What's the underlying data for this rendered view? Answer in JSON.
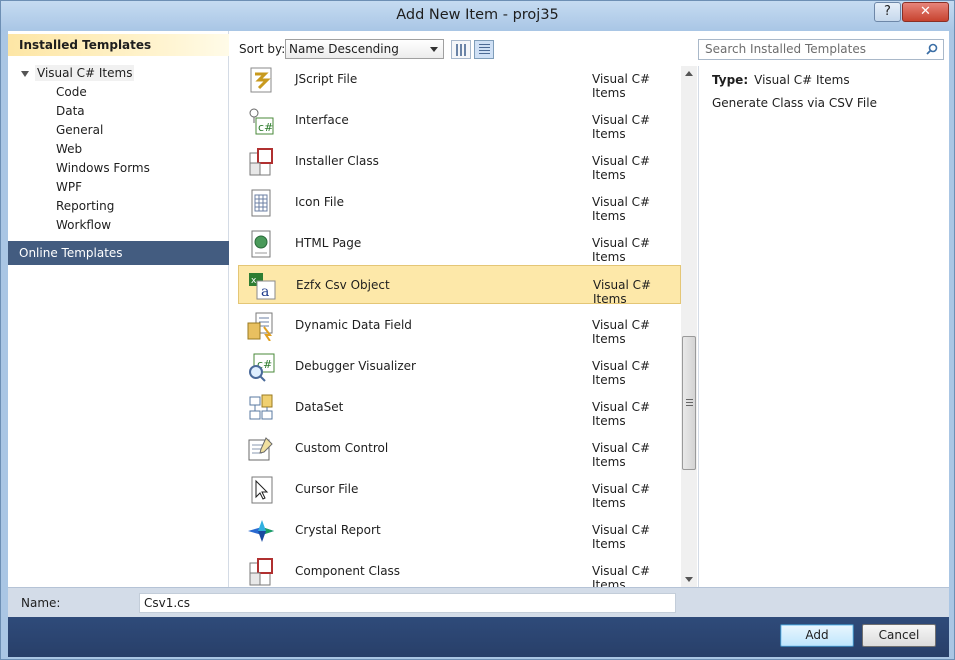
{
  "window": {
    "title": "Add New Item - proj35",
    "help_label": "?",
    "close_label": "✕"
  },
  "left": {
    "installed_header": "Installed Templates",
    "root_label": "Visual C# Items",
    "children": [
      "Code",
      "Data",
      "General",
      "Web",
      "Windows Forms",
      "WPF",
      "Reporting",
      "Workflow"
    ],
    "online_header": "Online Templates"
  },
  "toolbar": {
    "sort_label": "Sort by:",
    "sort_value": "Name Descending"
  },
  "search": {
    "placeholder": "Search Installed Templates"
  },
  "items": [
    {
      "name": "JScript File",
      "category": "Visual C# Items",
      "icon": "jscript-icon"
    },
    {
      "name": "Interface",
      "category": "Visual C# Items",
      "icon": "interface-icon"
    },
    {
      "name": "Installer Class",
      "category": "Visual C# Items",
      "icon": "installer-class-icon"
    },
    {
      "name": "Icon File",
      "category": "Visual C# Items",
      "icon": "icon-file-icon"
    },
    {
      "name": "HTML Page",
      "category": "Visual C# Items",
      "icon": "html-page-icon"
    },
    {
      "name": "Ezfx Csv Object",
      "category": "Visual C# Items",
      "icon": "csv-object-icon"
    },
    {
      "name": "Dynamic Data Field",
      "category": "Visual C# Items",
      "icon": "dynamic-data-icon"
    },
    {
      "name": "Debugger Visualizer",
      "category": "Visual C# Items",
      "icon": "debugger-visualizer-icon"
    },
    {
      "name": "DataSet",
      "category": "Visual C# Items",
      "icon": "dataset-icon"
    },
    {
      "name": "Custom Control",
      "category": "Visual C# Items",
      "icon": "custom-control-icon"
    },
    {
      "name": "Cursor File",
      "category": "Visual C# Items",
      "icon": "cursor-file-icon"
    },
    {
      "name": "Crystal Report",
      "category": "Visual C# Items",
      "icon": "crystal-report-icon"
    },
    {
      "name": "Component Class",
      "category": "Visual C# Items",
      "icon": "component-class-icon"
    }
  ],
  "details": {
    "type_label": "Type:",
    "type_value": "Visual C# Items",
    "description": "Generate Class via CSV File"
  },
  "name_field": {
    "label": "Name:",
    "value": "Csv1.cs"
  },
  "buttons": {
    "add": "Add",
    "cancel": "Cancel"
  },
  "colors": {
    "selected_bg": "#fde8a9",
    "online_header_bg": "#435c80",
    "footer_bg": "#2f4b7a"
  }
}
